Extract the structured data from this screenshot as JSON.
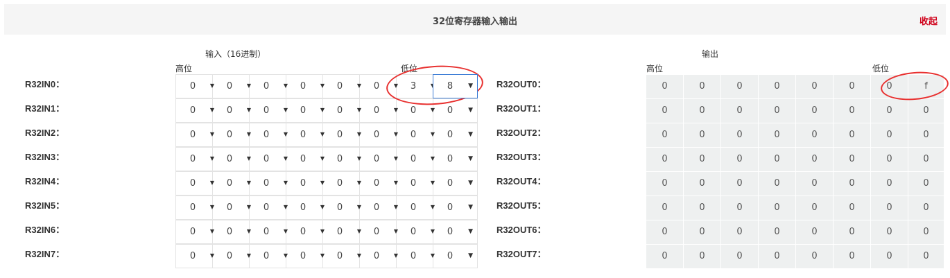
{
  "header": {
    "title": "32位寄存器输入输出",
    "collapse_label": "收起"
  },
  "input": {
    "title": "输入（16进制）",
    "high_label": "高位",
    "low_label": "低位",
    "rows": [
      {
        "label": "R32IN0：",
        "values": [
          "0",
          "0",
          "0",
          "0",
          "0",
          "0",
          "3",
          "8"
        ]
      },
      {
        "label": "R32IN1：",
        "values": [
          "0",
          "0",
          "0",
          "0",
          "0",
          "0",
          "0",
          "0"
        ]
      },
      {
        "label": "R32IN2：",
        "values": [
          "0",
          "0",
          "0",
          "0",
          "0",
          "0",
          "0",
          "0"
        ]
      },
      {
        "label": "R32IN3：",
        "values": [
          "0",
          "0",
          "0",
          "0",
          "0",
          "0",
          "0",
          "0"
        ]
      },
      {
        "label": "R32IN4：",
        "values": [
          "0",
          "0",
          "0",
          "0",
          "0",
          "0",
          "0",
          "0"
        ]
      },
      {
        "label": "R32IN5：",
        "values": [
          "0",
          "0",
          "0",
          "0",
          "0",
          "0",
          "0",
          "0"
        ]
      },
      {
        "label": "R32IN6：",
        "values": [
          "0",
          "0",
          "0",
          "0",
          "0",
          "0",
          "0",
          "0"
        ]
      },
      {
        "label": "R32IN7：",
        "values": [
          "0",
          "0",
          "0",
          "0",
          "0",
          "0",
          "0",
          "0"
        ]
      }
    ]
  },
  "output": {
    "title": "输出",
    "high_label": "高位",
    "low_label": "低位",
    "rows": [
      {
        "label": "R32OUT0：",
        "values": [
          "0",
          "0",
          "0",
          "0",
          "0",
          "0",
          "0",
          "f"
        ]
      },
      {
        "label": "R32OUT1：",
        "values": [
          "0",
          "0",
          "0",
          "0",
          "0",
          "0",
          "0",
          "0"
        ]
      },
      {
        "label": "R32OUT2：",
        "values": [
          "0",
          "0",
          "0",
          "0",
          "0",
          "0",
          "0",
          "0"
        ]
      },
      {
        "label": "R32OUT3：",
        "values": [
          "0",
          "0",
          "0",
          "0",
          "0",
          "0",
          "0",
          "0"
        ]
      },
      {
        "label": "R32OUT4：",
        "values": [
          "0",
          "0",
          "0",
          "0",
          "0",
          "0",
          "0",
          "0"
        ]
      },
      {
        "label": "R32OUT5：",
        "values": [
          "0",
          "0",
          "0",
          "0",
          "0",
          "0",
          "0",
          "0"
        ]
      },
      {
        "label": "R32OUT6：",
        "values": [
          "0",
          "0",
          "0",
          "0",
          "0",
          "0",
          "0",
          "0"
        ]
      },
      {
        "label": "R32OUT7：",
        "values": [
          "0",
          "0",
          "0",
          "0",
          "0",
          "0",
          "0",
          "0"
        ]
      }
    ]
  },
  "icons": {
    "select_arrow": "chevron-down-icon"
  },
  "colors": {
    "accent_red": "#d0021b",
    "annotation_red": "#e8302f",
    "focus_blue": "#3a7bd5",
    "output_bg": "#eef0f0",
    "header_bg": "#f5f5f5"
  }
}
